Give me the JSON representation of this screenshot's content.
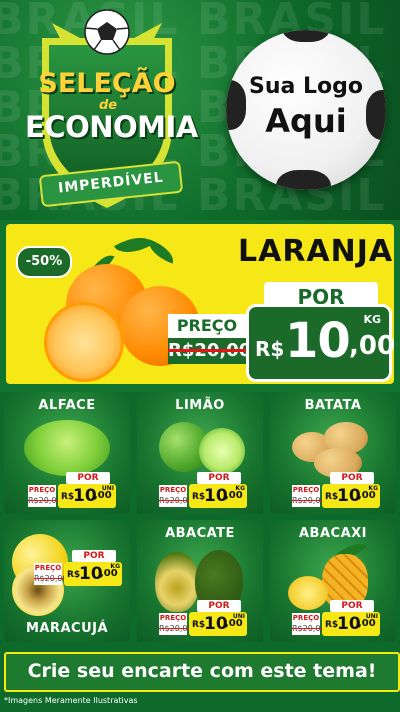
{
  "header": {
    "bg_words": [
      "BRASIL BRASIL BRASIL",
      "BRASIL BRASIL BRASIL",
      "BRASIL BRASIL BRASIL",
      "BRASIL BRASIL BRASIL",
      "BRASIL BRASIL BRASIL"
    ],
    "title_line1": "SELEÇÃO",
    "title_de": "de",
    "title_line2": "ECONOMIA",
    "ribbon": "IMPERDÍVEL",
    "logo_line1": "Sua Logo",
    "logo_line2": "Aqui"
  },
  "feature": {
    "badge": "-50%",
    "name": "LARANJA",
    "por": "POR",
    "preco_label": "PREÇO",
    "old_price": "R$20,00",
    "currency": "R$",
    "price_int": "10",
    "price_cents": ",00",
    "unit": "KG"
  },
  "products": [
    {
      "name": "ALFACE",
      "por": "POR",
      "preco": "PREÇO",
      "old": "R$20,00",
      "currency": "R$",
      "int": "10",
      "cents": ",00",
      "unit": "UNI"
    },
    {
      "name": "LIMÃO",
      "por": "POR",
      "preco": "PREÇO",
      "old": "R$20,00",
      "currency": "R$",
      "int": "10",
      "cents": ",00",
      "unit": "KG"
    },
    {
      "name": "BATATA",
      "por": "POR",
      "preco": "PREÇO",
      "old": "R$20,00",
      "currency": "R$",
      "int": "10",
      "cents": ",00",
      "unit": "KG"
    },
    {
      "name": "MARACUJÁ",
      "por": "POR",
      "preco": "PREÇO",
      "old": "R$20,00",
      "currency": "R$",
      "int": "10",
      "cents": ",00",
      "unit": "KG"
    },
    {
      "name": "ABACATE",
      "por": "POR",
      "preco": "PREÇO",
      "old": "R$20,00",
      "currency": "R$",
      "int": "10",
      "cents": ",00",
      "unit": "UNI"
    },
    {
      "name": "ABACAXI",
      "por": "POR",
      "preco": "PREÇO",
      "old": "R$20,00",
      "currency": "R$",
      "int": "10",
      "cents": ",00",
      "unit": "UNI"
    }
  ],
  "footer": {
    "cta": "Crie seu encarte com este tema!",
    "disclaimer": "*Imagens Meramente Ilustrativas"
  },
  "colors": {
    "green_dark": "#0e6a2b",
    "green_badge": "#1b6a2a",
    "yellow": "#f6e817",
    "red": "#d11a1a"
  }
}
